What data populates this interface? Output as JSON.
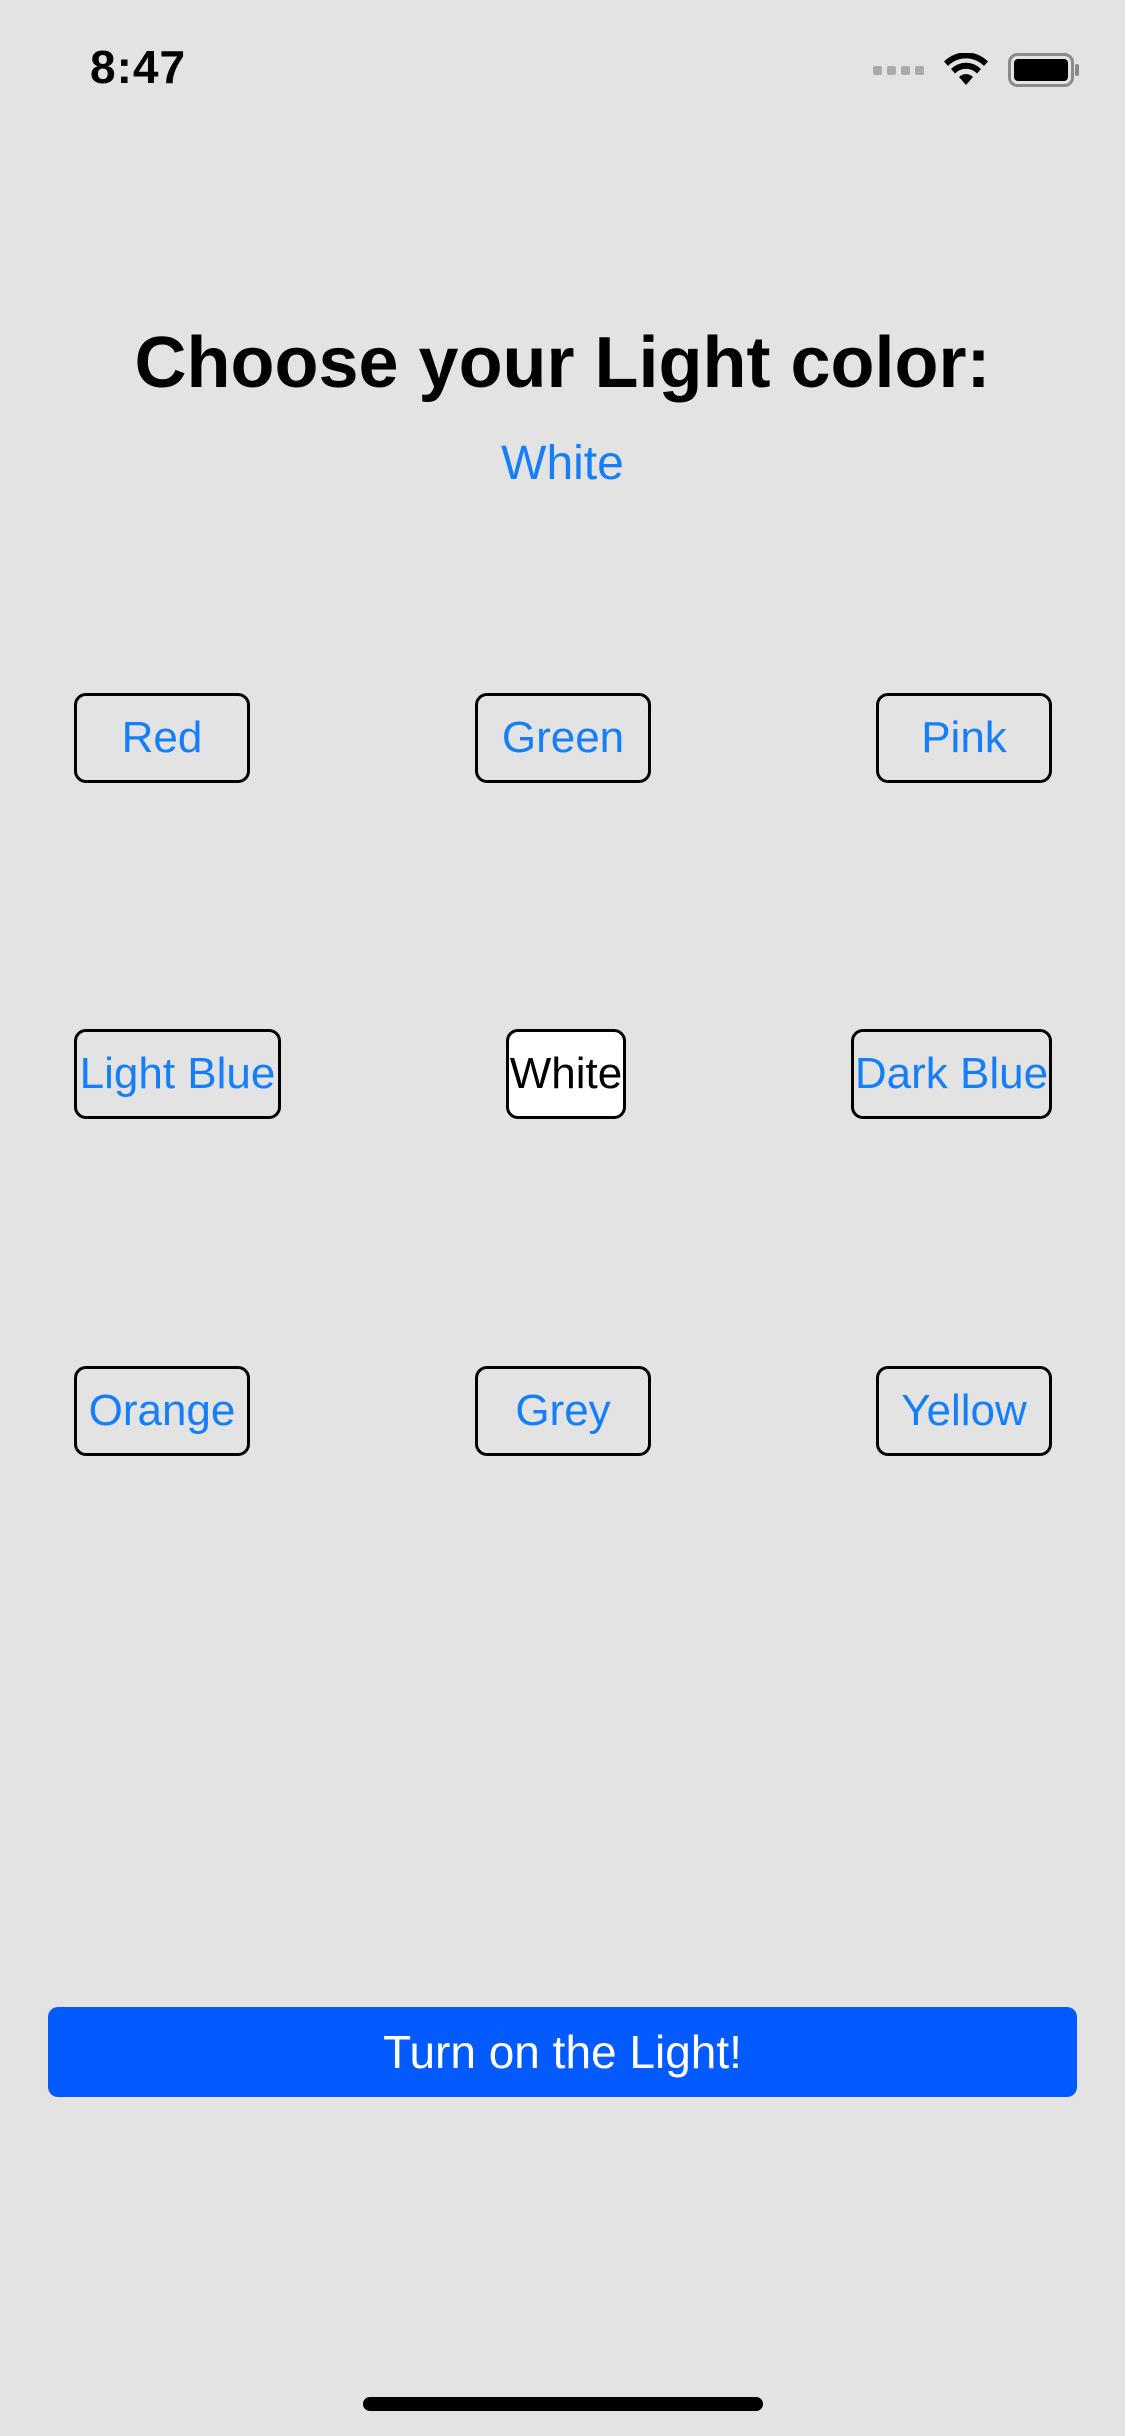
{
  "status_bar": {
    "time": "8:47",
    "wifi_icon": "wifi-icon",
    "battery_icon": "battery-icon",
    "signal_icon": "cellular-signal-icon"
  },
  "title": "Choose your Light color:",
  "selected_color": "White",
  "colors": {
    "red": "Red",
    "green": "Green",
    "pink": "Pink",
    "light_blue": "Light Blue",
    "white": "White",
    "dark_blue": "Dark Blue",
    "orange": "Orange",
    "grey": "Grey",
    "yellow": "Yellow"
  },
  "active_option": "White",
  "action_button": "Turn on the Light!",
  "theme": {
    "accent": "#147efb",
    "action_button_bg": "#035aff",
    "background": "#e3e3e3"
  }
}
